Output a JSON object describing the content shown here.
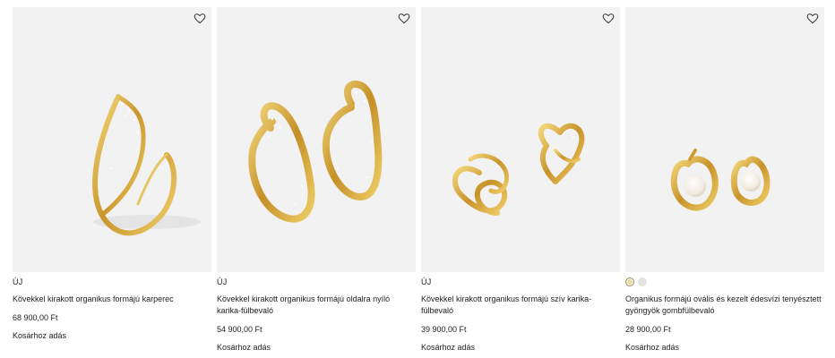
{
  "products": [
    {
      "badge": "ÚJ",
      "title": "Kövekkel kirakott organikus formájú karperec",
      "price": "68 900,00 Ft",
      "cart_label": "Kosárhoz adás"
    },
    {
      "badge": "ÚJ",
      "title": "Kövekkel kirakott organikus formájú oldalra nyíló karika-fülbevaló",
      "price": "54 900,00 Ft",
      "cart_label": "Kosárhoz adás"
    },
    {
      "badge": "ÚJ",
      "title": "Kövekkel kirakott organikus formájú szív karika-fülbevaló",
      "price": "39 900,00 Ft",
      "cart_label": "Kosárhoz adás"
    },
    {
      "swatches": [
        "gold",
        "silver"
      ],
      "title": "Organikus formájú ovális és kezelt édesvízi tenyésztett gyöngyök gombfülbevaló",
      "price": "28 900,00 Ft",
      "cart_label": "Kosárhoz adás"
    }
  ],
  "icons": {
    "wishlist": "heart-outline-icon"
  },
  "colors": {
    "image_bg": "#f2f2f2",
    "gold": "#d4a93a",
    "text": "#222222"
  }
}
